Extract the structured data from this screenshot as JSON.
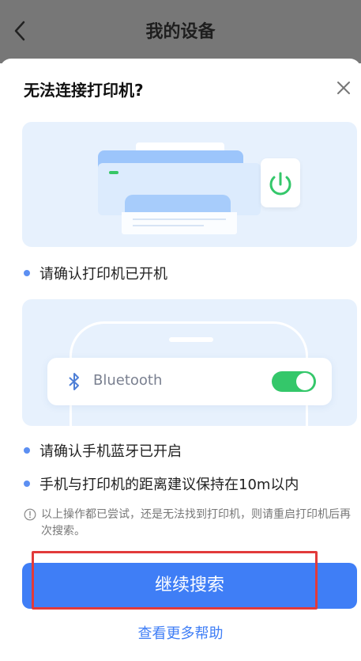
{
  "header": {
    "title": "我的设备"
  },
  "sheet": {
    "title": "无法连接打印机?",
    "bluetooth_label": "Bluetooth",
    "bluetooth_enabled": true,
    "checks": [
      "请确认打印机已开机",
      "请确认手机蓝牙已开启",
      "手机与打印机的距离建议保持在10m以内"
    ],
    "note": "以上操作都已尝试，还是无法找到打印机，则请重启打印机后再次搜索。",
    "primary_button": "继续搜索",
    "help_link": "查看更多帮助"
  },
  "colors": {
    "accent": "#3f7ef6",
    "card_bg": "#e7f1fd",
    "toggle_on": "#34c76a",
    "highlight_border": "#e23a3a"
  }
}
